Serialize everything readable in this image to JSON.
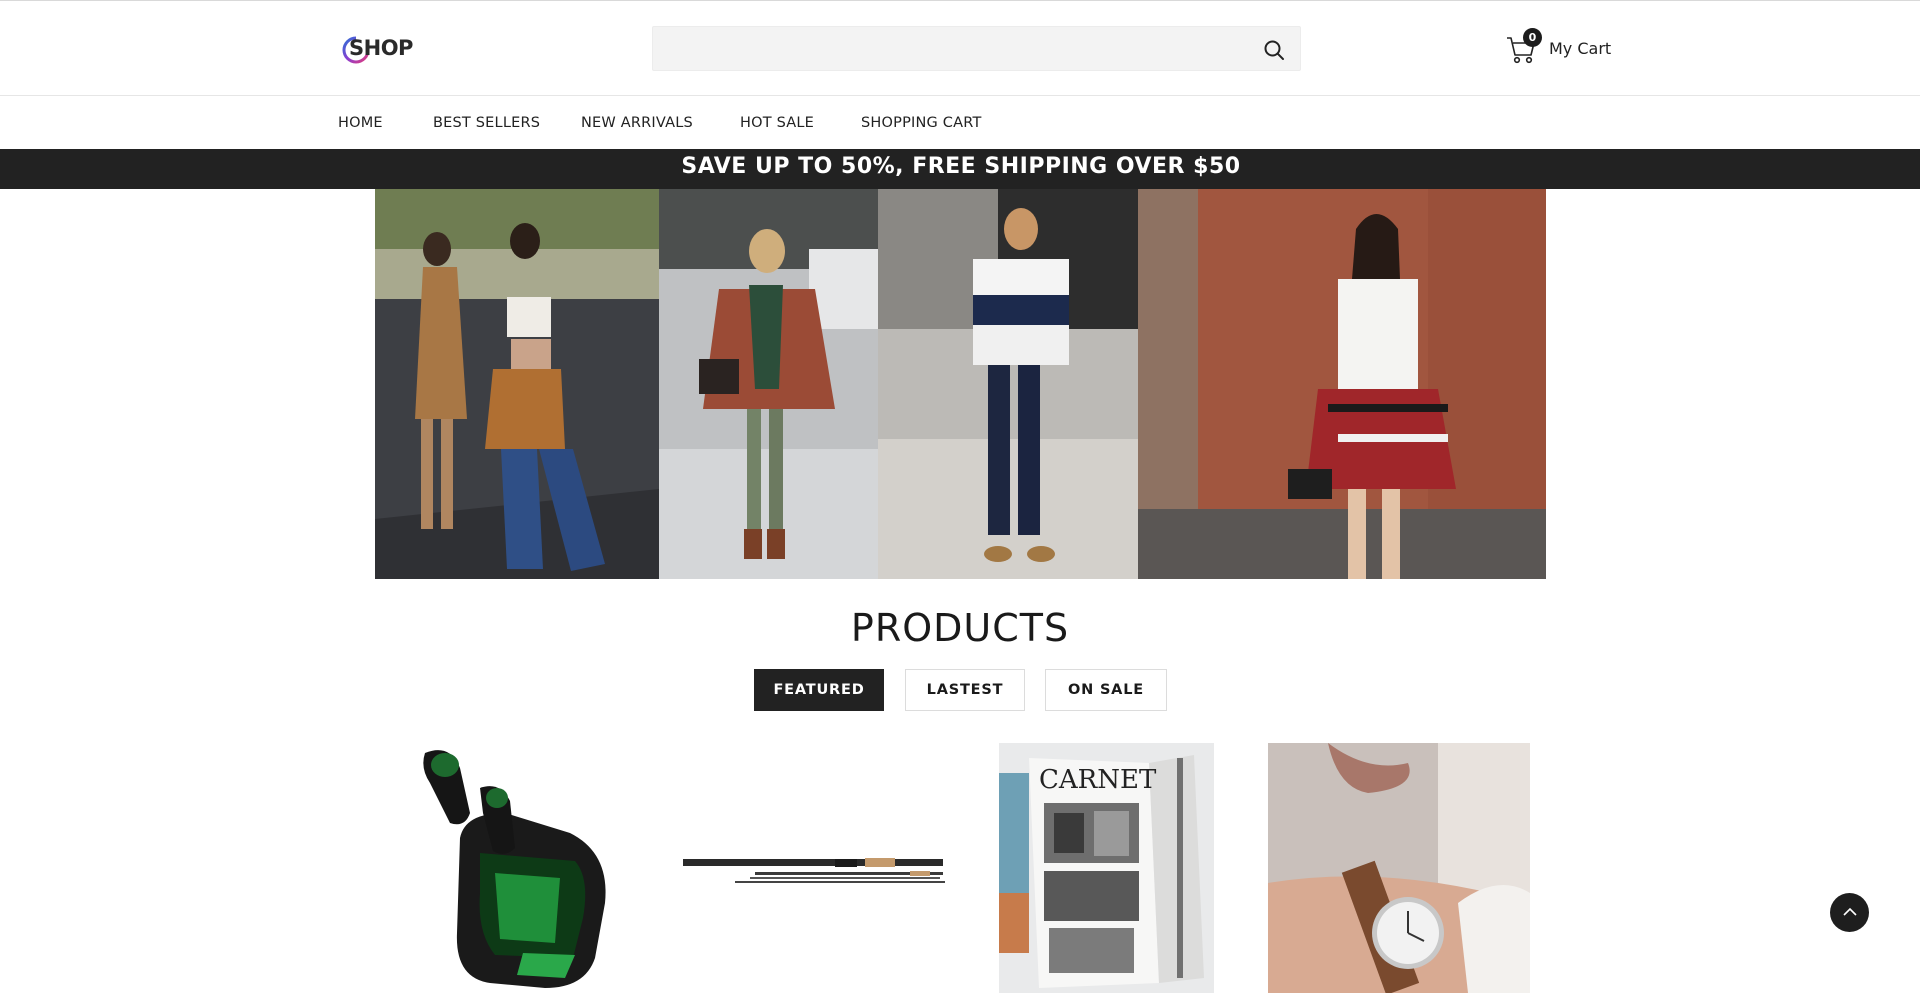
{
  "header": {
    "logo_text": "SHOP",
    "search": {
      "value": "",
      "placeholder": ""
    },
    "cart": {
      "count": "0",
      "label": "My Cart"
    }
  },
  "nav": {
    "items": [
      {
        "label": "HOME"
      },
      {
        "label": "BEST SELLERS"
      },
      {
        "label": "NEW ARRIVALS"
      },
      {
        "label": "HOT SALE"
      },
      {
        "label": "SHOPPING CART"
      }
    ]
  },
  "promo": {
    "text": "SAVE UP TO 50%, FREE SHIPPING OVER $50"
  },
  "hero": {
    "image": "street-fashion-banner"
  },
  "products": {
    "title": "PRODUCTS",
    "tabs": [
      {
        "label": "FEATURED",
        "active": true
      },
      {
        "label": "LASTEST",
        "active": false
      },
      {
        "label": "ON SALE",
        "active": false
      }
    ],
    "items": [
      {
        "image": "wireless-earbuds"
      },
      {
        "image": "fishing-rod"
      },
      {
        "image": "magazine"
      },
      {
        "image": "wrist-watch"
      }
    ]
  },
  "colors": {
    "dark": "#222222",
    "search_bg": "#f3f3f3",
    "border": "#e6e6e6"
  },
  "icons": {
    "search": "search-icon",
    "cart": "cart-icon",
    "scroll_top": "chevron-up-icon"
  }
}
